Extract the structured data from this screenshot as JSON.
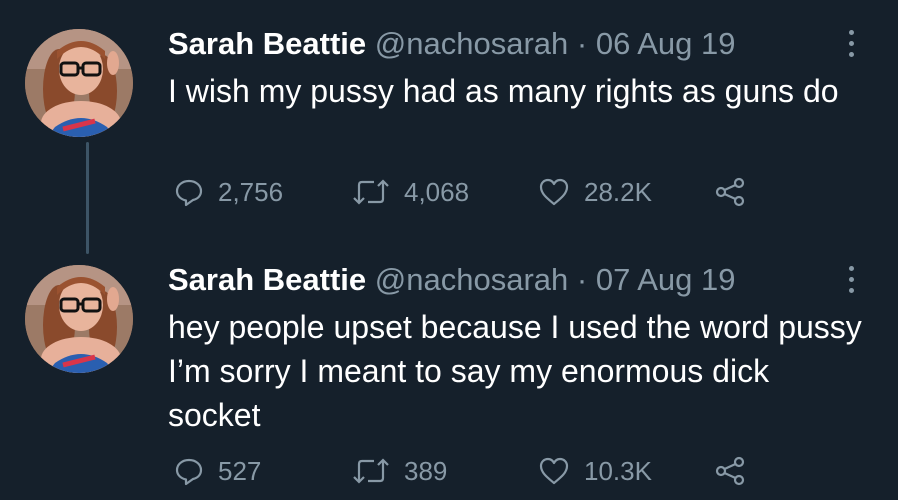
{
  "tweets": [
    {
      "name": "Sarah Beattie",
      "handle": "@nachosarah",
      "separator": "·",
      "date": "06 Aug 19",
      "text": "I wish my pussy had as many rights as guns do",
      "replies": "2,756",
      "retweets": "4,068",
      "likes": "28.2K"
    },
    {
      "name": "Sarah Beattie",
      "handle": "@nachosarah",
      "separator": "·",
      "date": "07 Aug 19",
      "text": "hey people upset because I used the word pussy I’m sorry I meant to say my enormous dick socket",
      "replies": "527",
      "retweets": "389",
      "likes": "10.3K"
    }
  ],
  "icons": {
    "reply": "reply-icon",
    "retweet": "retweet-icon",
    "like": "heart-icon",
    "share": "share-icon",
    "more": "more-options-icon"
  },
  "colors": {
    "background": "#15202b",
    "text": "#ffffff",
    "secondary": "#8899a6",
    "thread_line": "#3d5466"
  }
}
